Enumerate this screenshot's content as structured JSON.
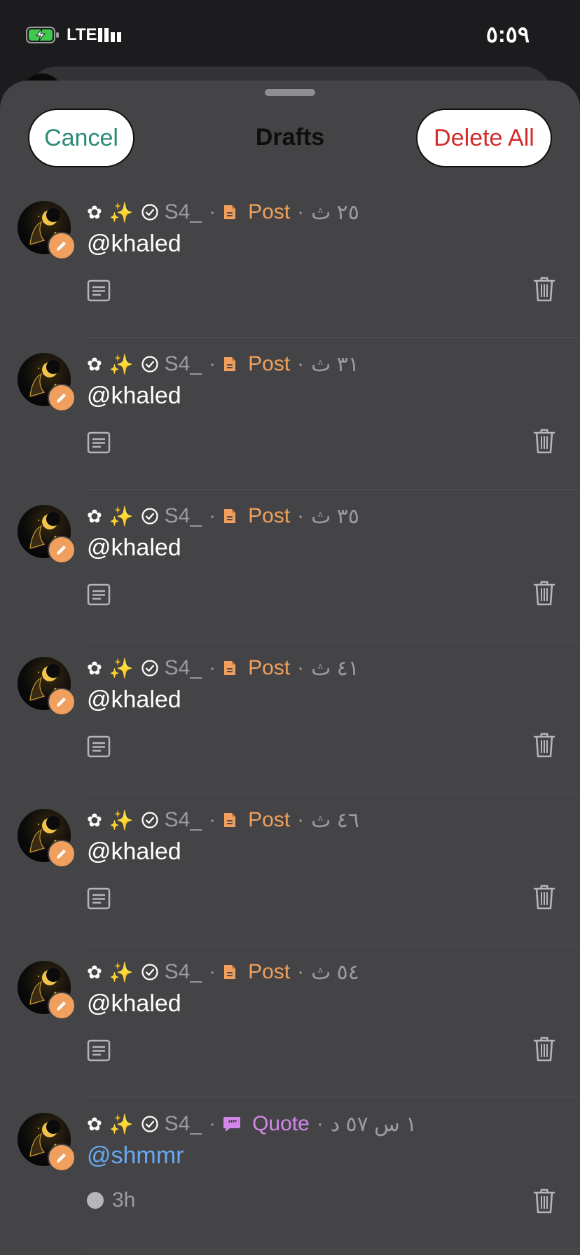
{
  "status_bar": {
    "network": "LTE",
    "time": "٥:٥٩"
  },
  "sheet": {
    "title": "Drafts",
    "cancel_label": "Cancel",
    "delete_all_label": "Delete All"
  },
  "drafts": [
    {
      "username": "S4_",
      "type": "Post",
      "time": "٢٥ ث",
      "mention": "@khaled"
    },
    {
      "username": "S4_",
      "type": "Post",
      "time": "٣١ ث",
      "mention": "@khaled"
    },
    {
      "username": "S4_",
      "type": "Post",
      "time": "٣٥ ث",
      "mention": "@khaled"
    },
    {
      "username": "S4_",
      "type": "Post",
      "time": "٤١ ث",
      "mention": "@khaled"
    },
    {
      "username": "S4_",
      "type": "Post",
      "time": "٤٦ ث",
      "mention": "@khaled"
    },
    {
      "username": "S4_",
      "type": "Post",
      "time": "٥٤ ث",
      "mention": "@khaled"
    },
    {
      "username": "S4_",
      "type": "Quote",
      "time": "١ س ٥٧ د",
      "mention": "@shmmr",
      "status": "3h"
    }
  ],
  "colors": {
    "post_accent": "#f0a05c",
    "quote_accent": "#d286e8",
    "link": "#66a9f2",
    "cancel": "#2b8a76",
    "delete": "#d12c2c",
    "sheet_bg": "#444446"
  },
  "icons": {
    "flower": "✿",
    "sparkle": "✨",
    "dot": "·"
  }
}
